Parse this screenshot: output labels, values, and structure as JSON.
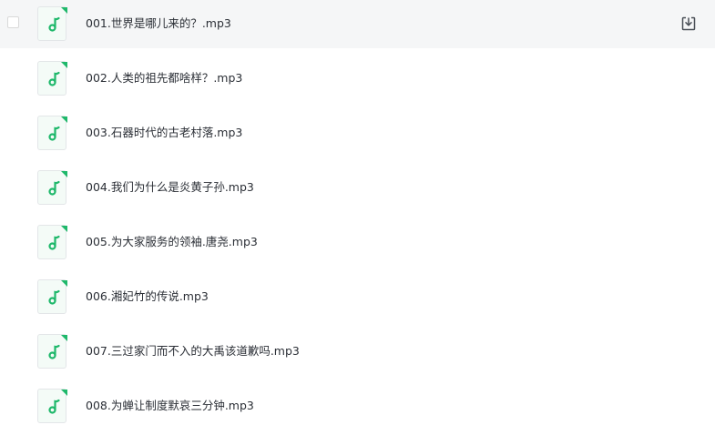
{
  "accent_color": "#1fb86b",
  "files": [
    {
      "name": "001.世界是哪儿来的？.mp3",
      "icon": "audio-file-icon"
    },
    {
      "name": "002.人类的祖先都啥样？.mp3",
      "icon": "audio-file-icon"
    },
    {
      "name": "003.石器时代的古老村落.mp3",
      "icon": "audio-file-icon"
    },
    {
      "name": "004.我们为什么是炎黄子孙.mp3",
      "icon": "audio-file-icon"
    },
    {
      "name": "005.为大家服务的领袖.唐尧.mp3",
      "icon": "audio-file-icon"
    },
    {
      "name": "006.湘妃竹的传说.mp3",
      "icon": "audio-file-icon"
    },
    {
      "name": "007.三过家门而不入的大禹该道歉吗.mp3",
      "icon": "audio-file-icon"
    },
    {
      "name": "008.为蝉让制度默哀三分钟.mp3",
      "icon": "audio-file-icon"
    }
  ],
  "row_actions": {
    "download_icon": "download-icon"
  }
}
